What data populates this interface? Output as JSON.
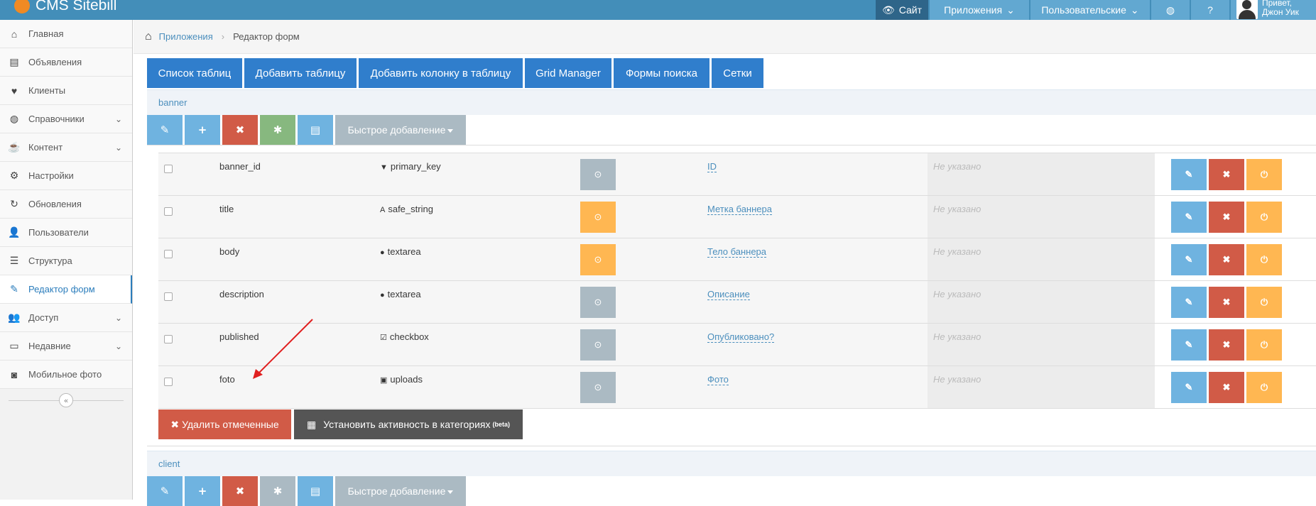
{
  "navbar": {
    "brand": "CMS Sitebill",
    "site_label": "Сайт",
    "apps_label": "Приложения",
    "users_label": "Пользовательские",
    "greeting": "Привет,",
    "username": "Джон Уик",
    "colors": {
      "navbar": "#438eb9",
      "button": "#62a8d1",
      "site_button": "#2e6589"
    }
  },
  "sidebar": {
    "items": [
      {
        "label": "Главная",
        "icon": "home-icon",
        "glyph": "⌂",
        "submenu": false,
        "active": false
      },
      {
        "label": "Объявления",
        "icon": "book-icon",
        "glyph": "▤",
        "submenu": false,
        "active": false
      },
      {
        "label": "Клиенты",
        "icon": "heart-icon",
        "glyph": "♥",
        "submenu": false,
        "active": false
      },
      {
        "label": "Справочники",
        "icon": "globe-icon",
        "glyph": "◍",
        "submenu": true,
        "active": false
      },
      {
        "label": "Контент",
        "icon": "coffee-icon",
        "glyph": "☕",
        "submenu": true,
        "active": false
      },
      {
        "label": "Настройки",
        "icon": "cog-icon",
        "glyph": "⚙",
        "submenu": false,
        "active": false
      },
      {
        "label": "Обновления",
        "icon": "refresh-icon",
        "glyph": "↻",
        "submenu": false,
        "active": false
      },
      {
        "label": "Пользователи",
        "icon": "user-icon",
        "glyph": "👤",
        "submenu": false,
        "active": false
      },
      {
        "label": "Структура",
        "icon": "list-icon",
        "glyph": "☰",
        "submenu": false,
        "active": false
      },
      {
        "label": "Редактор форм",
        "icon": "edit-icon",
        "glyph": "✎",
        "submenu": false,
        "active": true
      },
      {
        "label": "Доступ",
        "icon": "group-icon",
        "glyph": "👥",
        "submenu": true,
        "active": false
      },
      {
        "label": "Недавние",
        "icon": "desktop-icon",
        "glyph": "▭",
        "submenu": true,
        "active": false
      },
      {
        "label": "Мобильное фото",
        "icon": "camera-icon",
        "glyph": "◙",
        "submenu": false,
        "active": false
      }
    ]
  },
  "breadcrumb": {
    "link": "Приложения",
    "current": "Редактор форм"
  },
  "tabs": [
    "Список таблиц",
    "Добавить таблицу",
    "Добавить колонку в таблицу",
    "Grid Manager",
    "Формы поиска",
    "Сетки"
  ],
  "sections": [
    {
      "name": "banner",
      "quick_add": "Быстрое добавление"
    },
    {
      "name": "client",
      "quick_add": "Быстрое добавление"
    }
  ],
  "columns": [
    {
      "name": "banner_id",
      "type": "primary_key",
      "type_icon": "filter-icon",
      "type_glyph": "▼",
      "status": "grey",
      "label": "ID",
      "default": "Не указано"
    },
    {
      "name": "title",
      "type": "safe_string",
      "type_icon": "font-icon",
      "type_glyph": "A",
      "status": "orange",
      "label": "Метка баннера",
      "default": "Не указано"
    },
    {
      "name": "body",
      "type": "textarea",
      "type_icon": "comment-icon",
      "type_glyph": "●",
      "status": "orange",
      "label": "Тело баннера",
      "default": "Не указано"
    },
    {
      "name": "description",
      "type": "textarea",
      "type_icon": "comment-icon",
      "type_glyph": "●",
      "status": "grey",
      "label": "Описание",
      "default": "Не указано"
    },
    {
      "name": "published",
      "type": "checkbox",
      "type_icon": "check-square-icon",
      "type_glyph": "☑",
      "status": "grey",
      "label": "Опубликовано?",
      "default": "Не указано"
    },
    {
      "name": "foto",
      "type": "uploads",
      "type_icon": "picture-icon",
      "type_glyph": "▣",
      "status": "grey",
      "label": "Фото",
      "default": "Не указано"
    }
  ],
  "bottom": {
    "delete_selected": "Удалить отмеченные",
    "set_activity": "Установить активность в категориях",
    "beta": "(beta)"
  },
  "colors": {
    "primary_tab": "#307ecc",
    "edit": "#6fb3e0",
    "delete": "#d15b47",
    "power": "#ffb752",
    "annotation_arrow": "#e02020"
  }
}
